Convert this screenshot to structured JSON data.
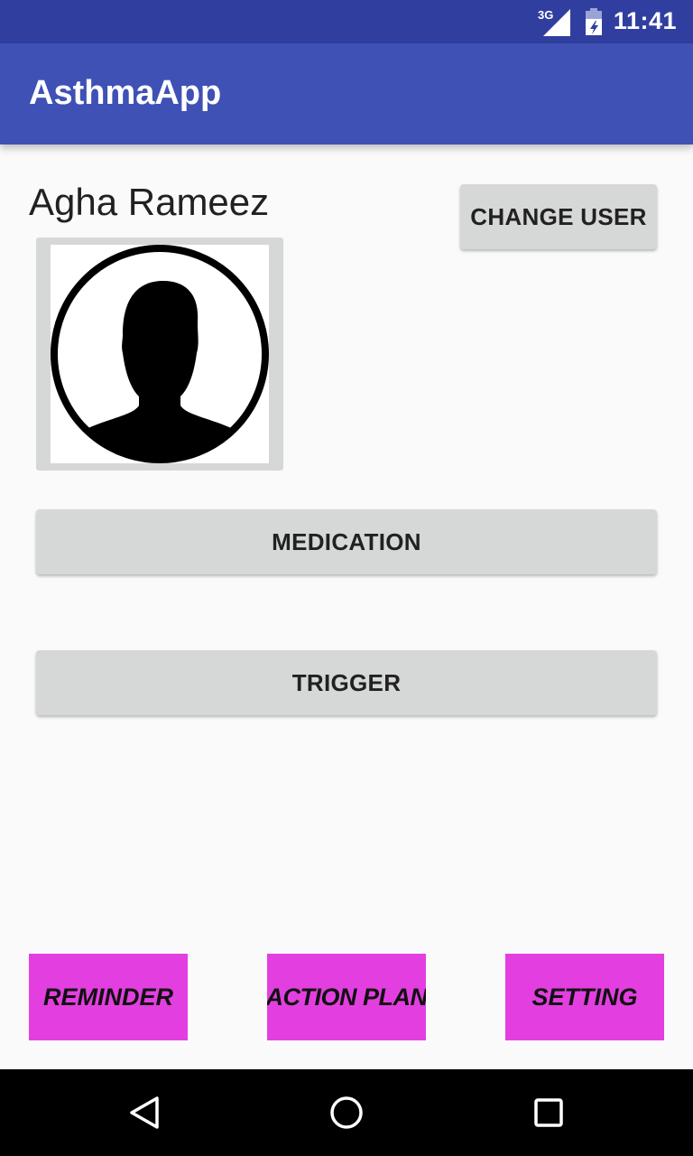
{
  "status_bar": {
    "network": "3G",
    "time": "11:41",
    "icons": [
      "signal-icon",
      "battery-icon"
    ]
  },
  "app_bar": {
    "title": "AsthmaApp"
  },
  "profile": {
    "user_name": "Agha Rameez",
    "change_user_label": "CHANGE USER",
    "avatar_icon": "user-avatar-icon"
  },
  "main": {
    "medication_label": "MEDICATION",
    "trigger_label": "TRIGGER"
  },
  "bottom_buttons": {
    "reminder_label": "REMINDER",
    "action_plan_label": "ACTION PLAN",
    "setting_label": "SETTING",
    "color": "#e33fe0"
  },
  "system_nav": {
    "icons": [
      "back-icon",
      "home-icon",
      "recents-icon"
    ]
  },
  "colors": {
    "status_bar": "#303f9f",
    "app_bar": "#3f51b5",
    "button_bg": "#d6d7d7",
    "background": "#fafafa"
  }
}
